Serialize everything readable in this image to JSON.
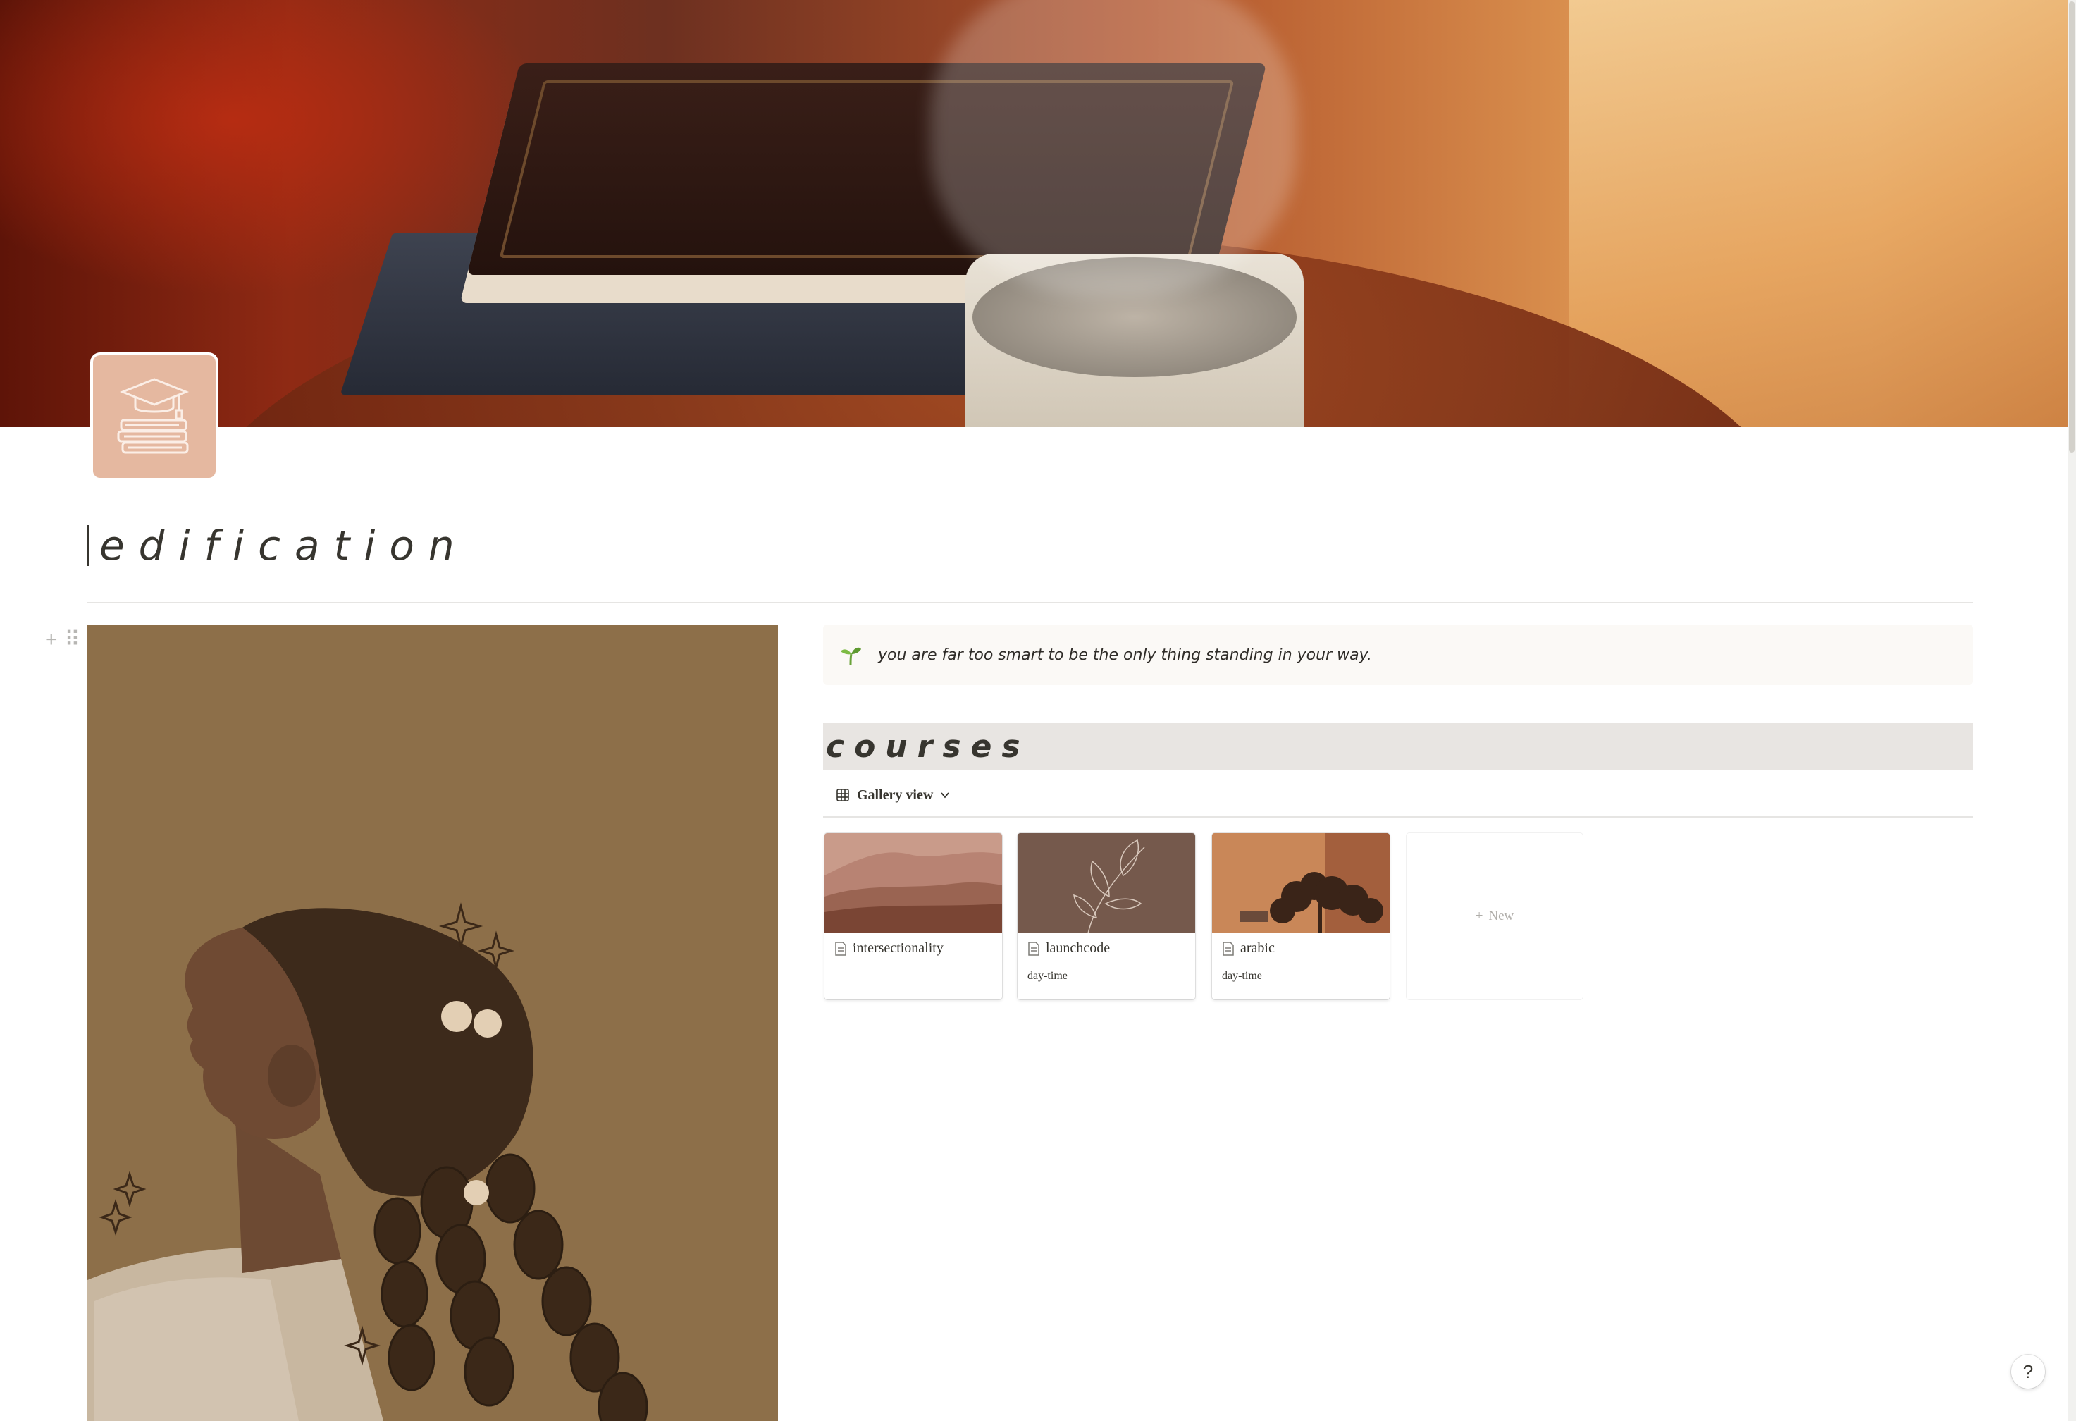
{
  "page": {
    "title": "edification",
    "icon": "graduation-cap-books-icon",
    "cover": "books-and-mug-illustration"
  },
  "callout": {
    "icon": "sprout-icon",
    "text": "you are far too smart to be the only thing standing in your way."
  },
  "courses": {
    "heading": "courses",
    "view": {
      "label": "Gallery view",
      "icon": "gallery-grid-icon"
    },
    "cards": [
      {
        "title": "intersectionality",
        "property": "",
        "cover": "desert-dunes"
      },
      {
        "title": "launchcode",
        "property": "day-time",
        "cover": "leaf-line-art"
      },
      {
        "title": "arabic",
        "property": "day-time",
        "cover": "tree-at-sunset"
      }
    ],
    "new_label": "New"
  },
  "help": {
    "label": "?"
  },
  "colors": {
    "icon_bg": "#e5b8a0",
    "illustration_bg": "#8d6f49",
    "courses_bg": "#e8e5e2",
    "callout_bg": "#fbf9f6"
  }
}
